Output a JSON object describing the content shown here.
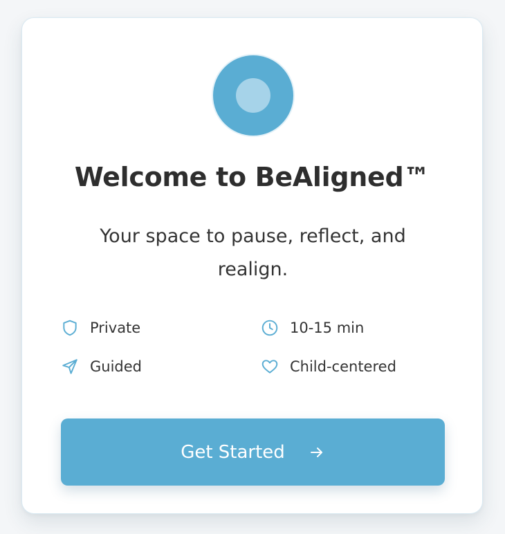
{
  "brand": {
    "accent_color": "#5aadd3",
    "accent_light": "#a6d3e9",
    "logo_icon": "circle-logo-icon"
  },
  "welcome": {
    "title": "Welcome to BeAligned™",
    "subtitle": "Your space to pause, reflect, and realign."
  },
  "features": [
    {
      "label": "Private",
      "icon": "shield-icon"
    },
    {
      "label": "10-15 min",
      "icon": "clock-icon"
    },
    {
      "label": "Guided",
      "icon": "send-icon"
    },
    {
      "label": "Child-centered",
      "icon": "heart-icon"
    }
  ],
  "cta": {
    "label": "Get Started",
    "icon": "arrow-right-icon"
  }
}
